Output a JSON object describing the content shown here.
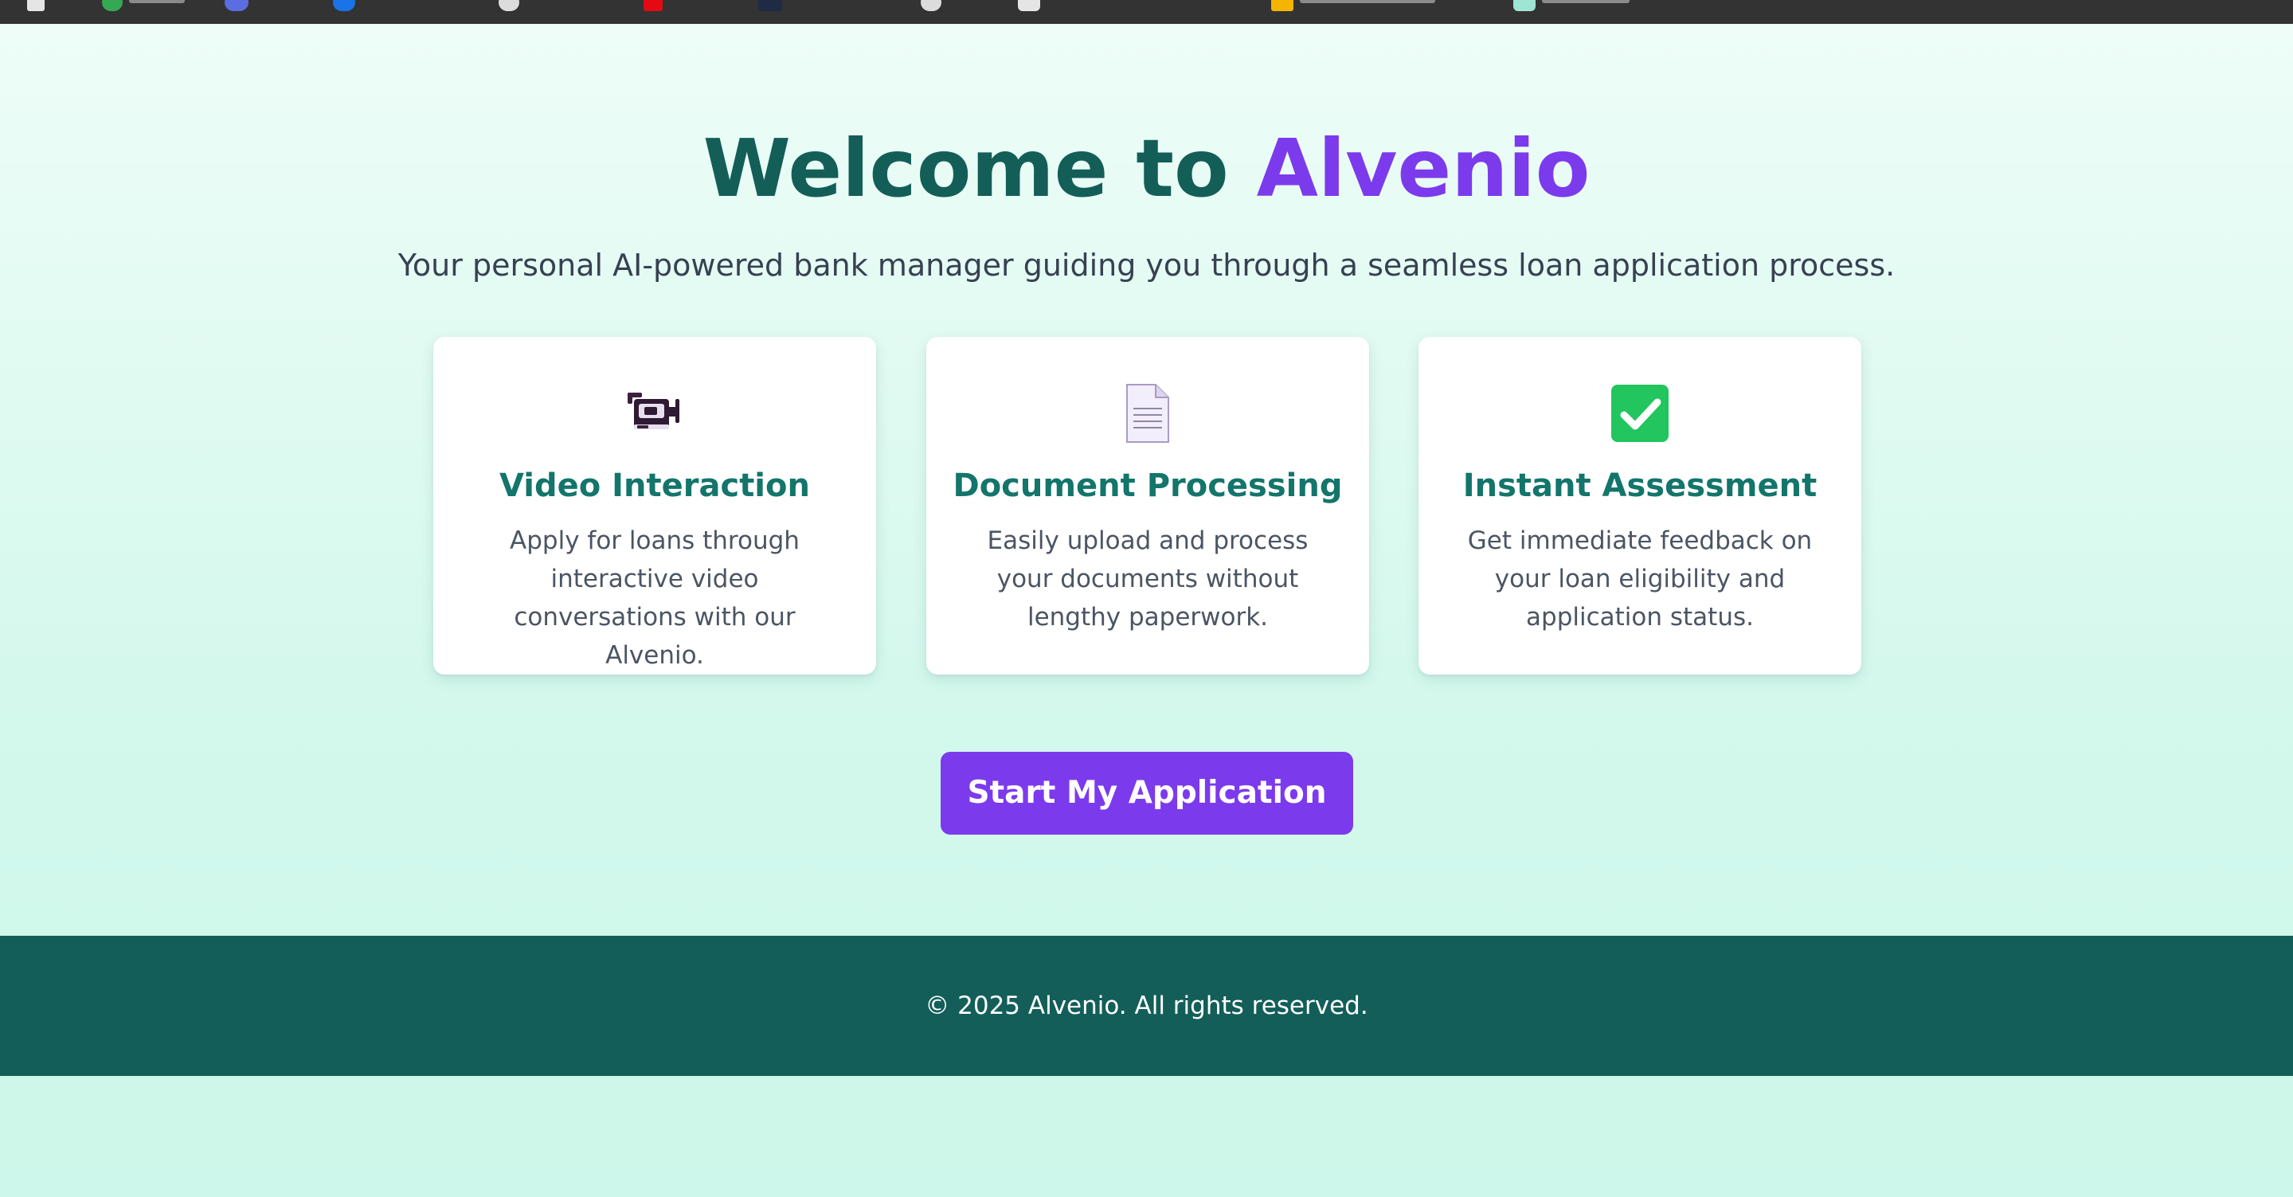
{
  "hero": {
    "title_prefix": "Welcome to ",
    "title_brand": "Alvenio",
    "subtitle": "Your personal AI-powered bank manager guiding you through a seamless loan application process."
  },
  "features": [
    {
      "icon": "video-camera-icon",
      "title": "Video Interaction",
      "description": "Apply for loans through interactive video conversations with our Alvenio."
    },
    {
      "icon": "document-icon",
      "title": "Document Processing",
      "description": "Easily upload and process your documents without lengthy paperwork."
    },
    {
      "icon": "check-mark-icon",
      "title": "Instant Assessment",
      "description": "Get immediate feedback on your loan eligibility and application status."
    }
  ],
  "cta": {
    "label": "Start My Application"
  },
  "footer": {
    "text": "© 2025 Alvenio. All rights reserved."
  },
  "colors": {
    "primary_teal": "#145e58",
    "accent_purple": "#7c3aed",
    "card_title_teal": "#13756b",
    "footer_bg": "#135e59",
    "check_green": "#22c55e"
  }
}
